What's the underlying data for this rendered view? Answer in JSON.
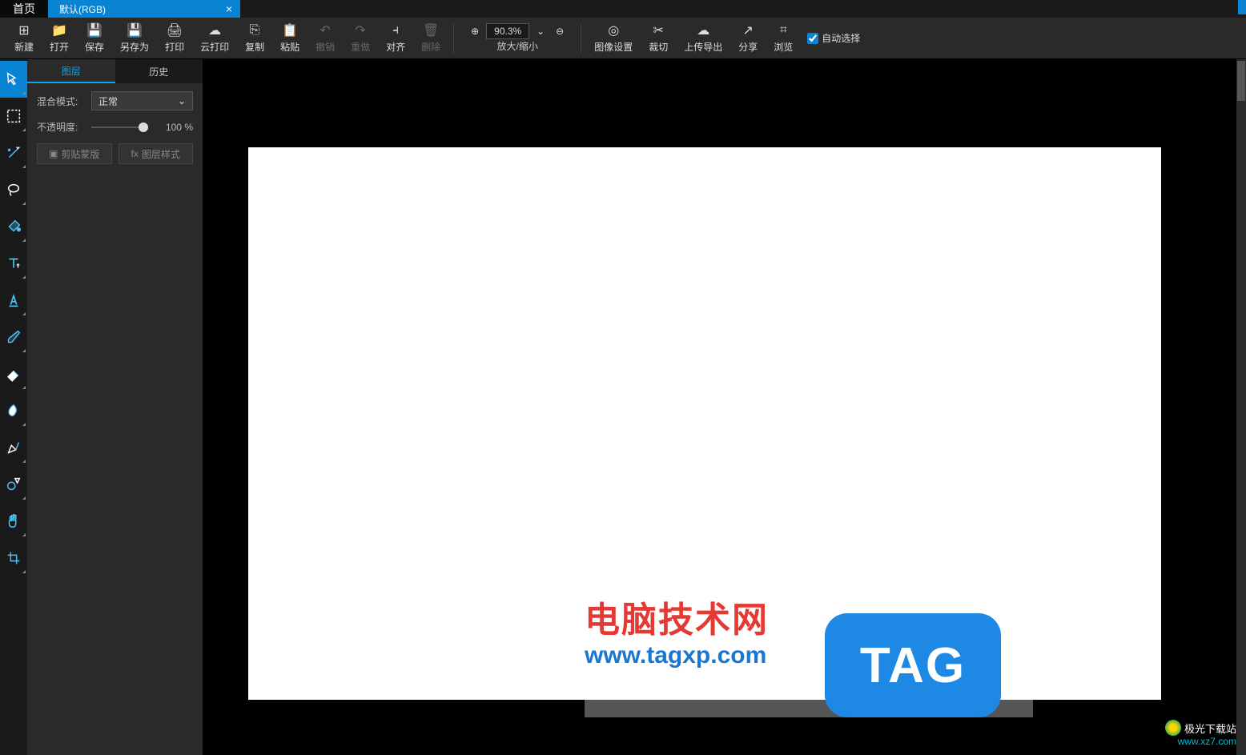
{
  "title_bar": {
    "home": "首页",
    "doc_tab": "默认(RGB)",
    "close": "×"
  },
  "toolbar": {
    "items": [
      {
        "label": "新建",
        "icon": "⊞"
      },
      {
        "label": "打开",
        "icon": "📁"
      },
      {
        "label": "保存",
        "icon": "💾"
      },
      {
        "label": "另存为",
        "icon": "💾"
      },
      {
        "label": "打印",
        "icon": "🖨"
      },
      {
        "label": "云打印",
        "icon": "☁"
      },
      {
        "label": "复制",
        "icon": "⎘"
      },
      {
        "label": "粘贴",
        "icon": "📋"
      },
      {
        "label": "撤销",
        "icon": "↶",
        "disabled": true
      },
      {
        "label": "重做",
        "icon": "↷",
        "disabled": true
      },
      {
        "label": "对齐",
        "icon": "⫞"
      },
      {
        "label": "删除",
        "icon": "🗑",
        "disabled": true
      }
    ],
    "zoom": {
      "label": "放大/缩小",
      "value": "90.3%"
    },
    "items2": [
      {
        "label": "图像设置",
        "icon": "◎"
      },
      {
        "label": "裁切",
        "icon": "✂"
      },
      {
        "label": "上传导出",
        "icon": "☁"
      },
      {
        "label": "分享",
        "icon": "↗"
      },
      {
        "label": "浏览",
        "icon": "⌗"
      }
    ],
    "auto_select": "自动选择"
  },
  "toolbox": [
    {
      "name": "move-tool",
      "active": true
    },
    {
      "name": "marquee-tool"
    },
    {
      "name": "magic-wand-tool"
    },
    {
      "name": "lasso-tool"
    },
    {
      "name": "paint-bucket-tool"
    },
    {
      "name": "text-tool"
    },
    {
      "name": "text-style-tool"
    },
    {
      "name": "brush-tool"
    },
    {
      "name": "eraser-tool"
    },
    {
      "name": "smudge-tool"
    },
    {
      "name": "pen-tool"
    },
    {
      "name": "shape-tool"
    },
    {
      "name": "hand-tool"
    },
    {
      "name": "crop-tool"
    }
  ],
  "side_panel": {
    "tabs": {
      "layers": "图层",
      "history": "历史"
    },
    "blend": {
      "label": "混合模式:",
      "value": "正常"
    },
    "opacity": {
      "label": "不透明度:",
      "value": "100",
      "unit": "%"
    },
    "btn_clip": "剪贴蒙版",
    "btn_style": "图层样式"
  },
  "watermark": {
    "title": "电脑技术网",
    "url": "www.tagxp.com",
    "badge": "TAG"
  },
  "corner": {
    "name": "极光下载站",
    "url": "www.xz7.com"
  }
}
